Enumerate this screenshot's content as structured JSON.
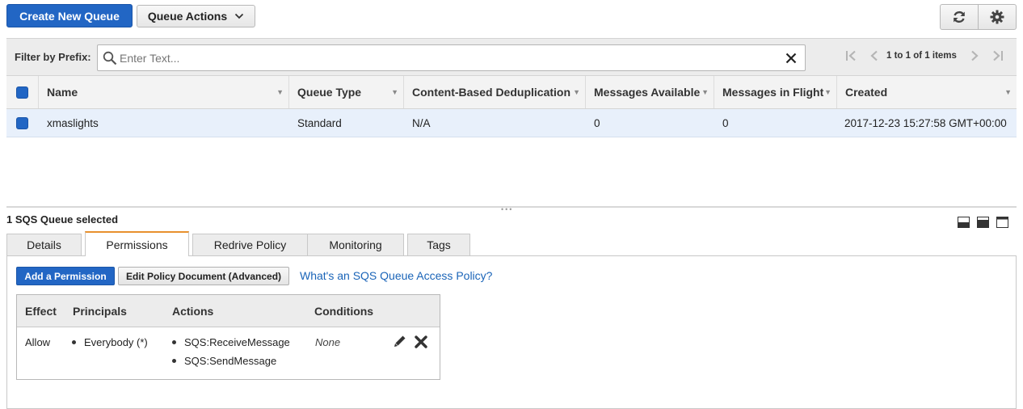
{
  "toolbar": {
    "create_label": "Create New Queue",
    "actions_label": "Queue Actions",
    "refresh_icon": "refresh-icon",
    "settings_icon": "gear-icon"
  },
  "filter": {
    "label": "Filter by Prefix:",
    "placeholder": "Enter Text...",
    "pagination": "1 to 1 of 1 items"
  },
  "table": {
    "columns": [
      "Name",
      "Queue Type",
      "Content-Based Deduplication",
      "Messages Available",
      "Messages in Flight",
      "Created"
    ],
    "rows": [
      {
        "name": "xmaslights",
        "queue_type": "Standard",
        "dedup": "N/A",
        "available": "0",
        "in_flight": "0",
        "created": "2017-12-23 15:27:58 GMT+00:00"
      }
    ]
  },
  "detail": {
    "selected_text": "1 SQS Queue selected",
    "tabs": [
      "Details",
      "Permissions",
      "Redrive Policy",
      "Monitoring",
      "Tags"
    ],
    "active_tab": "Permissions",
    "add_permission_label": "Add a Permission",
    "edit_policy_label": "Edit Policy Document (Advanced)",
    "policy_link": "What's an SQS Queue Access Policy?"
  },
  "permissions": {
    "columns": [
      "Effect",
      "Principals",
      "Actions",
      "Conditions"
    ],
    "rows": [
      {
        "effect": "Allow",
        "principals": [
          "Everybody (*)"
        ],
        "actions": [
          "SQS:ReceiveMessage",
          "SQS:SendMessage"
        ],
        "conditions": "None"
      }
    ]
  },
  "colors": {
    "primary": "#2266c4",
    "active_tab_accent": "#e8912d",
    "selected_row": "#e8f0fb",
    "link": "#1a64b8"
  }
}
